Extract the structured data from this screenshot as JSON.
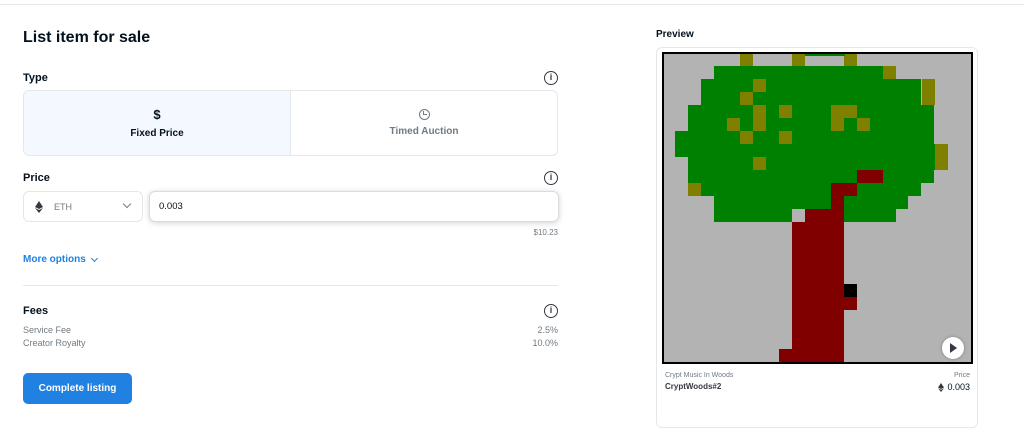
{
  "form": {
    "title": "List item for sale",
    "type_label": "Type",
    "type_options": [
      {
        "label": "Fixed Price",
        "icon": "dollar-icon",
        "active": true
      },
      {
        "label": "Timed Auction",
        "icon": "clock-icon",
        "active": false
      }
    ],
    "price_label": "Price",
    "currency": "ETH",
    "price_value": "0.003",
    "usd_value": "$10.23",
    "more_options": "More options",
    "fees_label": "Fees",
    "fees": [
      {
        "label": "Service Fee",
        "value": "2.5%"
      },
      {
        "label": "Creator Royalty",
        "value": "10.0%"
      }
    ],
    "complete_button": "Complete listing"
  },
  "preview": {
    "label": "Preview",
    "collection": "Crypt Music In Woods",
    "name": "CryptWoods#2",
    "price_label": "Price",
    "price": "0.003"
  },
  "colors": {
    "accent": "#2081e2",
    "sky": "#b3b3b3",
    "leaves": "#008000",
    "fruit": "#808000",
    "trunk": "#800000"
  }
}
